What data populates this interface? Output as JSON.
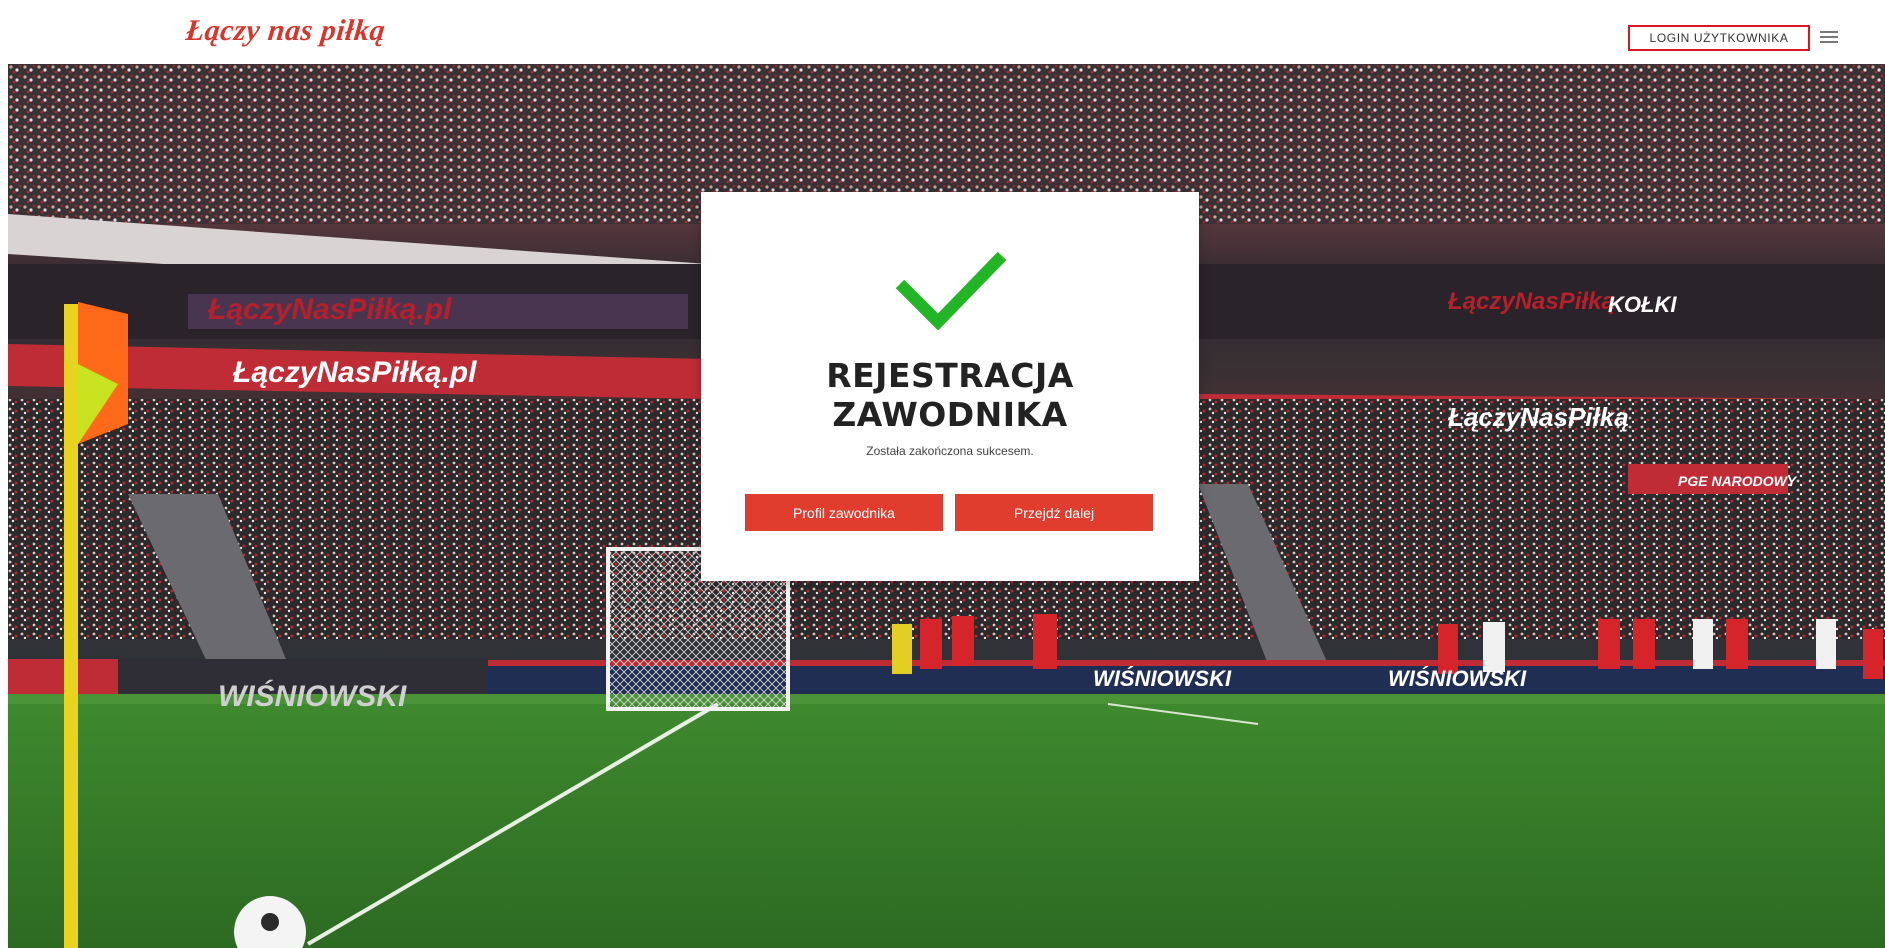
{
  "header": {
    "logo_text": "Łączy nas piłką",
    "login_label": "LOGIN UŻYTKOWNIKA",
    "menu_icon": "hamburger-icon"
  },
  "hero": {
    "banner_texts": [
      "ŁączyNasPiłką.pl",
      "ŁączyNasPiłką",
      "WIŚNIOWSKI",
      "PGE NARODOWY",
      "KOŁKI"
    ]
  },
  "modal": {
    "title_line1": "REJESTRACJA",
    "title_line2": "ZAWODNIKA",
    "subtitle": "Została zakończona sukcesem.",
    "profile_button": "Profil zawodnika",
    "next_button": "Przejdź dalej",
    "icon": "check-icon"
  },
  "colors": {
    "accent_red": "#e03d2e",
    "logo_red": "#d9352a",
    "check_green": "#22b526"
  }
}
